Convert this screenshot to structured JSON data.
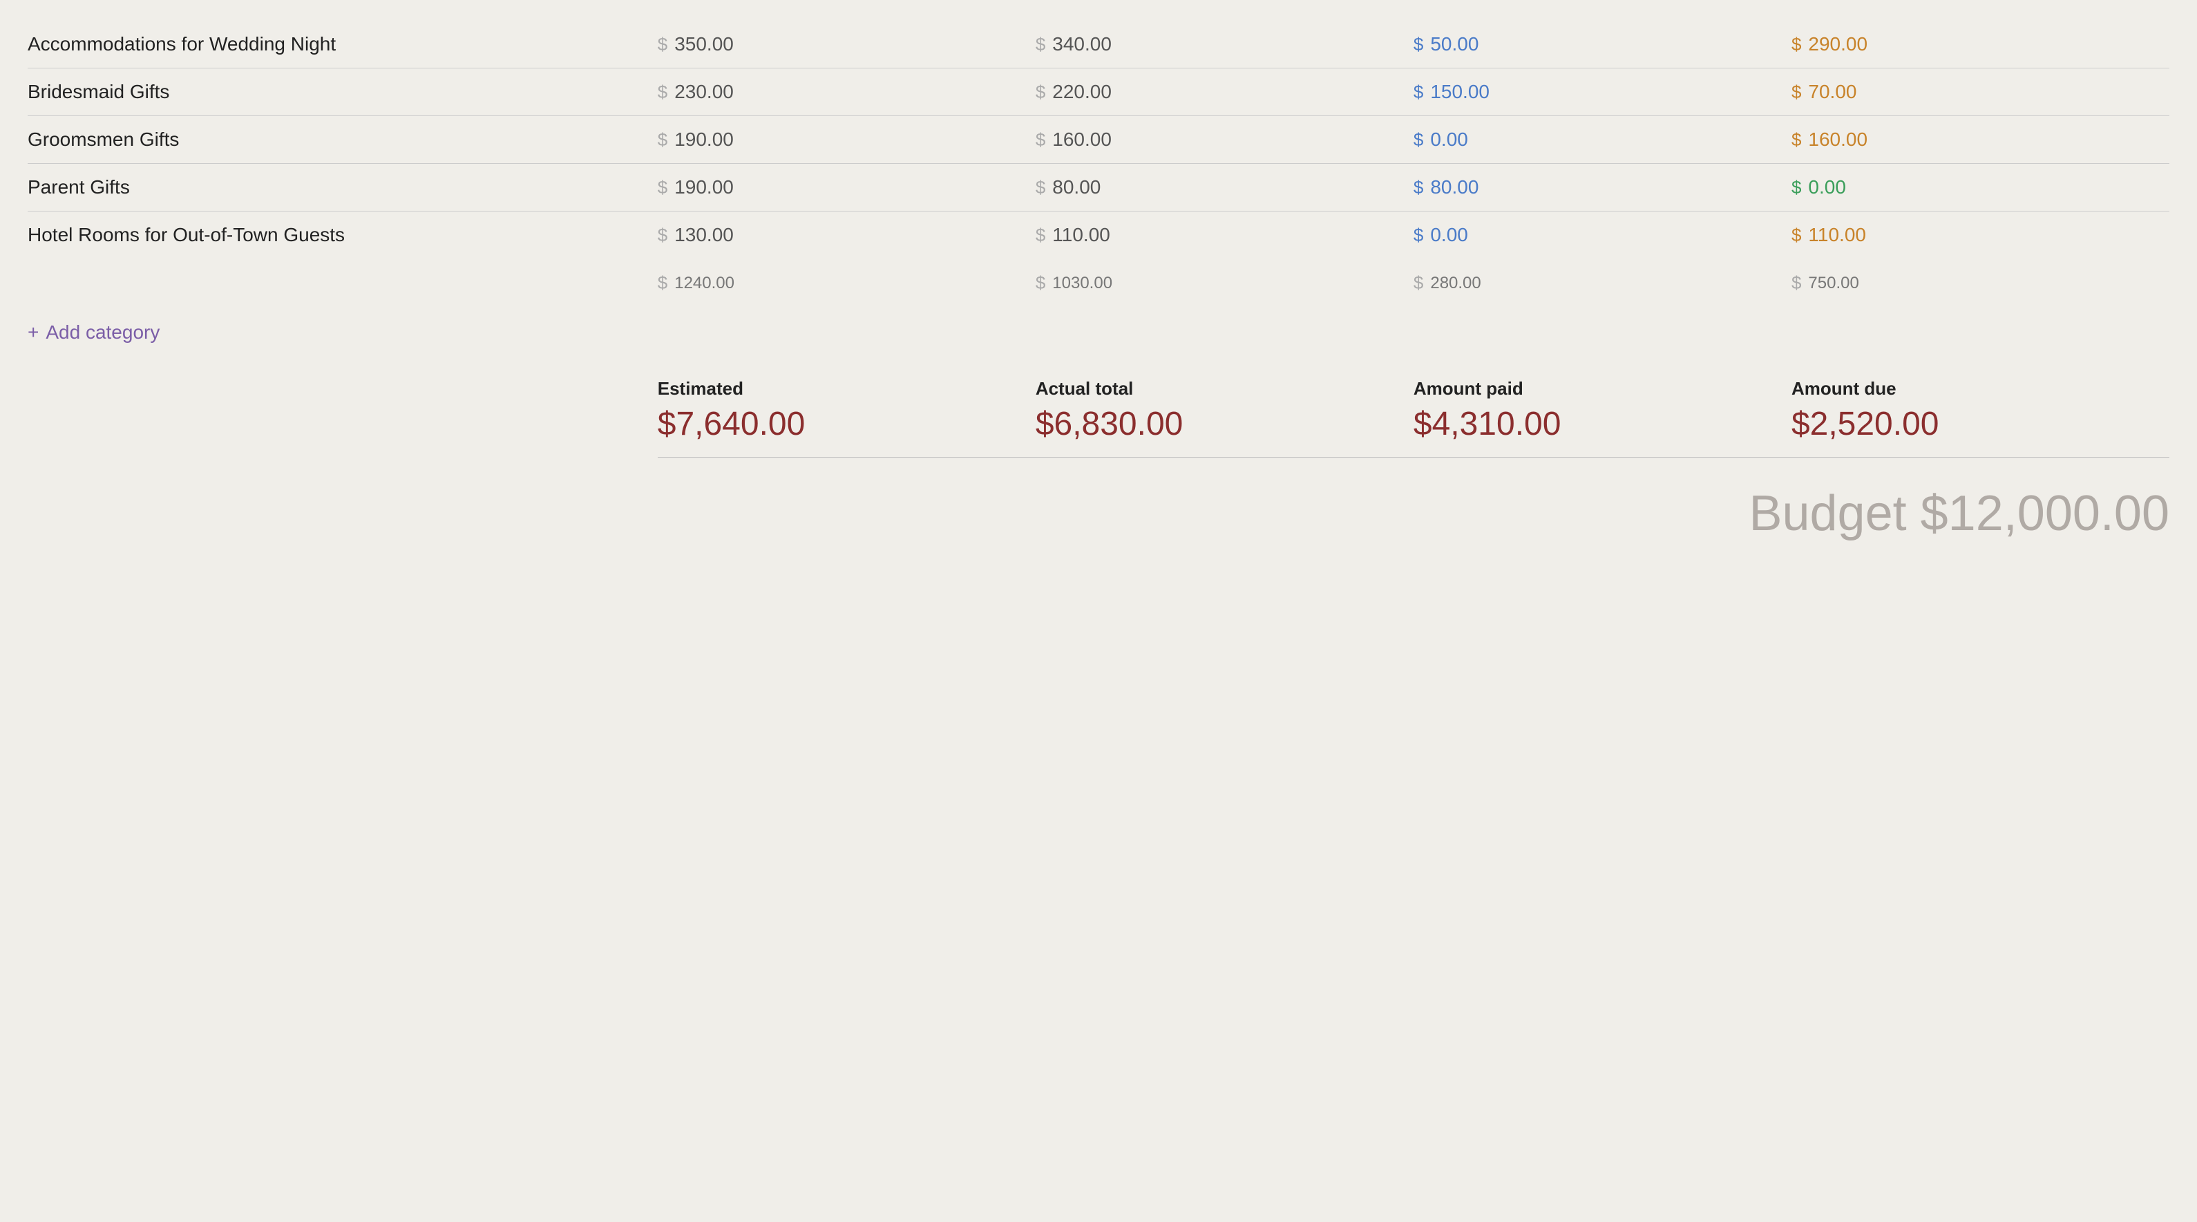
{
  "rows": [
    {
      "name": "Accommodations for Wedding Night",
      "estimated": "350.00",
      "actual": "340.00",
      "paid": "50.00",
      "due": "290.00",
      "due_color": "orange"
    },
    {
      "name": "Bridesmaid Gifts",
      "estimated": "230.00",
      "actual": "220.00",
      "paid": "150.00",
      "due": "70.00",
      "due_color": "orange"
    },
    {
      "name": "Groomsmen Gifts",
      "estimated": "190.00",
      "actual": "160.00",
      "paid": "0.00",
      "due": "160.00",
      "due_color": "orange"
    },
    {
      "name": "Parent Gifts",
      "estimated": "190.00",
      "actual": "80.00",
      "paid": "80.00",
      "due": "0.00",
      "due_color": "green"
    },
    {
      "name": "Hotel Rooms for Out-of-Town Guests",
      "estimated": "130.00",
      "actual": "110.00",
      "paid": "0.00",
      "due": "110.00",
      "due_color": "orange"
    }
  ],
  "totals": {
    "estimated": "1240.00",
    "actual": "1030.00",
    "paid": "280.00",
    "due": "750.00"
  },
  "add_category_label": "Add category",
  "summary": {
    "estimated_label": "Estimated",
    "estimated_value": "$7,640.00",
    "actual_label": "Actual total",
    "actual_value": "$6,830.00",
    "paid_label": "Amount paid",
    "paid_value": "$4,310.00",
    "due_label": "Amount due",
    "due_value": "$2,520.00"
  },
  "budget_total": "Budget $12,000.00"
}
